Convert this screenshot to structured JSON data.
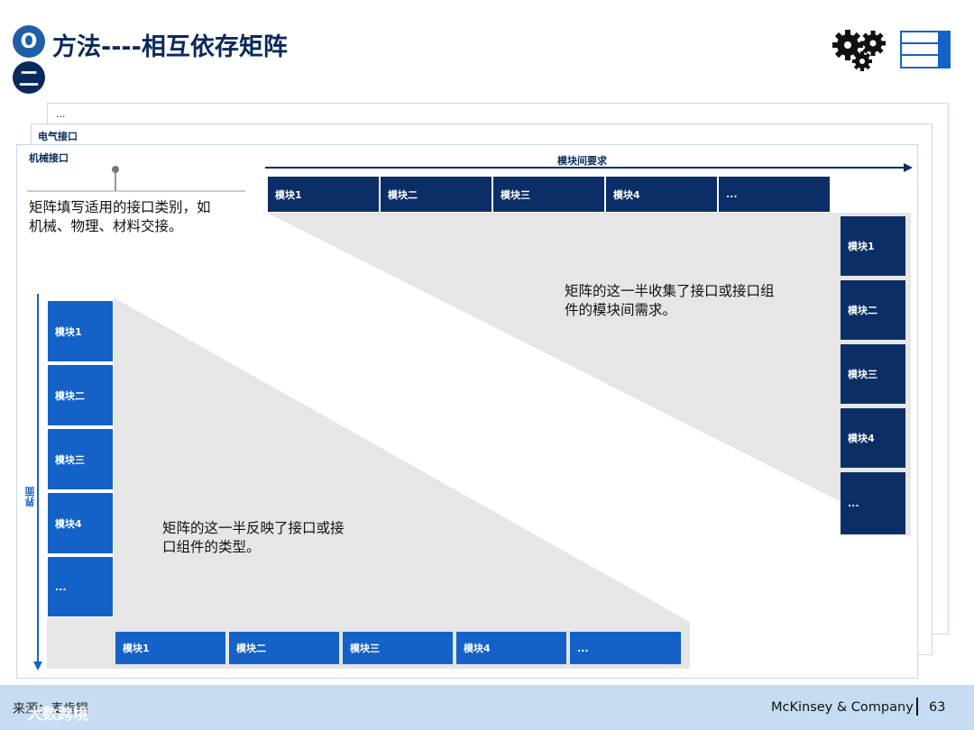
{
  "header": {
    "section_number": "O",
    "section_number_2": "二",
    "title": "方法----相互依存矩阵"
  },
  "icons": {
    "gears": "gears-icon",
    "table": "table-icon"
  },
  "sheets": {
    "back_label": "...",
    "middle_label": "电气接口",
    "front_label": "机械接口"
  },
  "top_axis": {
    "label": "模块间要求"
  },
  "side_axis": {
    "label": "界面"
  },
  "top_row": [
    "模块1",
    "模块二",
    "模块三",
    "模块4",
    "..."
  ],
  "right_column": [
    "模块1",
    "模块二",
    "模块三",
    "模块4",
    "..."
  ],
  "left_column": [
    "模块1",
    "模块二",
    "模块三",
    "模块4",
    "..."
  ],
  "bottom_row": [
    "模块1",
    "模块二",
    "模块三",
    "模块4",
    "..."
  ],
  "notes": {
    "callout_line1": "矩阵填写适用的接口类别，如",
    "callout_line2": "机械、物理、材料交接。",
    "upper_half_line1": "矩阵的这一半收集了接口或接口组",
    "upper_half_line2": "件的模块间需求。",
    "lower_half_line1": "矩阵的这一半反映了接口或接",
    "lower_half_line2": "口组件的类型。"
  },
  "footer": {
    "source": "来源：麦肯锡",
    "watermark": "大数跨境",
    "company": "McKinsey & Company",
    "page": "63"
  },
  "colors": {
    "dark_navy": "#0b2e66",
    "bright_blue": "#1462c8",
    "triangle_gray": "#e6e6e6",
    "footer_bg": "#c5dcf3"
  }
}
